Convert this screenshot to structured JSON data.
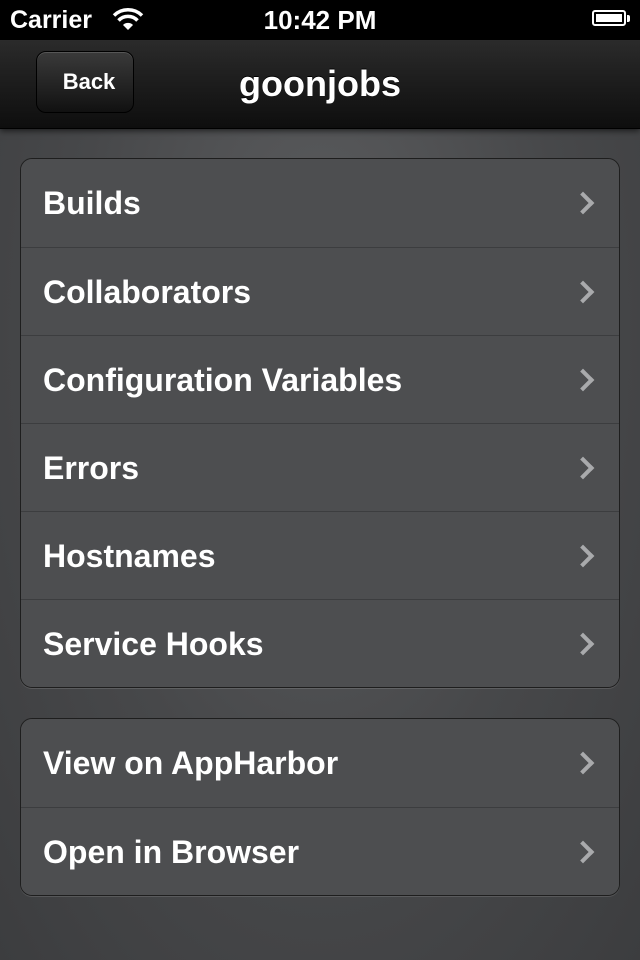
{
  "status_bar": {
    "carrier": "Carrier",
    "time": "10:42 PM",
    "wifi_icon": "wifi-icon",
    "battery_icon": "battery-icon"
  },
  "nav_bar": {
    "back_label": "Back",
    "title": "goonjobs"
  },
  "groups": [
    {
      "items": [
        {
          "label": "Builds",
          "icon": "chevron-right-icon"
        },
        {
          "label": "Collaborators",
          "icon": "chevron-right-icon"
        },
        {
          "label": "Configuration Variables",
          "icon": "chevron-right-icon"
        },
        {
          "label": "Errors",
          "icon": "chevron-right-icon"
        },
        {
          "label": "Hostnames",
          "icon": "chevron-right-icon"
        },
        {
          "label": "Service Hooks",
          "icon": "chevron-right-icon"
        }
      ]
    },
    {
      "items": [
        {
          "label": "View on AppHarbor",
          "icon": "chevron-right-icon"
        },
        {
          "label": "Open in Browser",
          "icon": "chevron-right-icon"
        }
      ]
    }
  ],
  "colors": {
    "background": "#47484a",
    "cell": "#4d4e50",
    "nav_bar": "#1c1c1c",
    "chevron": "#a9aaac",
    "text": "#ffffff"
  }
}
